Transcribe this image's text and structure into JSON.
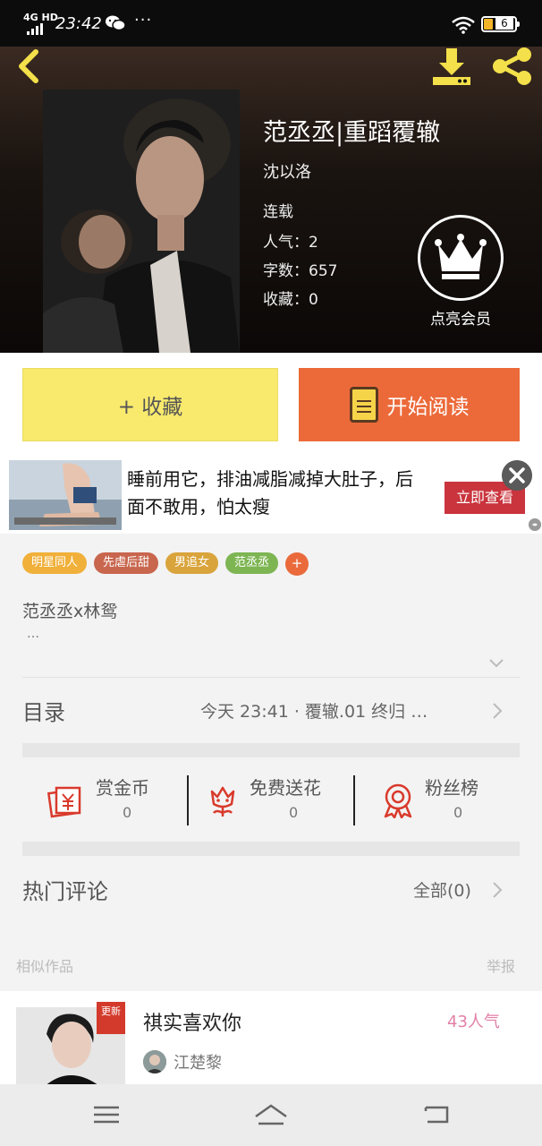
{
  "status_bar": {
    "network": "4G HD",
    "time": "23:42",
    "overflow": "···",
    "battery_level": "6",
    "battery_color": "#f2b529"
  },
  "header": {
    "back_icon": "chevron-left-icon",
    "download_icon": "download-icon",
    "share_icon": "share-icon",
    "accent_color": "#f3e04a"
  },
  "book": {
    "title": "范丞丞|重蹈覆辙",
    "author": "沈以洛",
    "status": "连载",
    "popularity": "人气：2",
    "word_count": "字数：657",
    "favorites": "收藏：0",
    "vip_label": "点亮会员"
  },
  "actions": {
    "favorite_label": "+ 收藏",
    "read_label": "开始阅读",
    "favorite_color": "#f9ea6e",
    "read_color": "#ec6a3a"
  },
  "ad": {
    "text": "睡前用它，排油减脂减掉大肚子，后面不敢用，怕太瘦",
    "cta": "立即查看",
    "cta_color": "#c9343d"
  },
  "tags": [
    {
      "label": "明星同人",
      "color": "#f0b03a"
    },
    {
      "label": "先虐后甜",
      "color": "#c8664e"
    },
    {
      "label": "男追女",
      "color": "#d9a43c"
    },
    {
      "label": "范丞丞",
      "color": "#7eb553"
    }
  ],
  "tag_add": "+",
  "synopsis": {
    "text": "范丞丞x林鸳",
    "more": "…"
  },
  "catalog": {
    "label": "目录",
    "latest": "今天 23:41 · 覆辙.01 终归 …"
  },
  "stats": [
    {
      "name": "赏金币",
      "count": "0",
      "icon": "red-envelope-icon"
    },
    {
      "name": "免费送花",
      "count": "0",
      "icon": "flower-icon"
    },
    {
      "name": "粉丝榜",
      "count": "0",
      "icon": "medal-icon"
    }
  ],
  "comments": {
    "label": "热门评论",
    "all": "全部(0)"
  },
  "similar": {
    "label": "相似作品",
    "report": "举报",
    "item": {
      "title": "祺实喜欢你",
      "popularity": "43人气",
      "author": "江楚黎",
      "badge": "更新"
    }
  },
  "nav": {
    "menu_icon": "menu-icon",
    "home_icon": "home-icon",
    "back_icon": "back-icon"
  }
}
